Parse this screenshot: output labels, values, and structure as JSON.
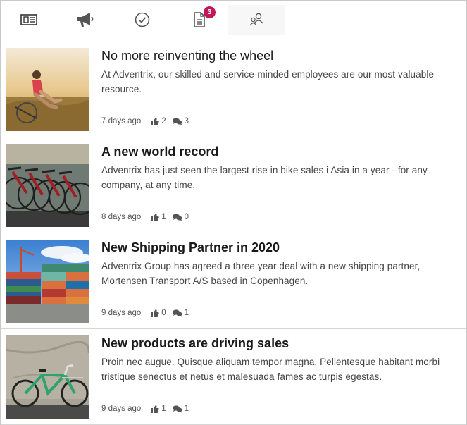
{
  "tabs": [
    {
      "icon": "newspaper-icon",
      "label": ""
    },
    {
      "icon": "megaphone-icon",
      "label": ""
    },
    {
      "icon": "check-circle-icon",
      "label": ""
    },
    {
      "icon": "document-icon",
      "badge": "3"
    },
    {
      "icon": "people-icon",
      "active": true
    }
  ],
  "colors": {
    "badge": "#c0185a",
    "icon": "#555555",
    "divider": "#d6d6d6"
  },
  "news": [
    {
      "title": "No more reinventing the wheel",
      "body": "At Adventrix, our skilled and service-minded employees are our most valuable resource.",
      "age": "7 days ago",
      "likes": "2",
      "comments": "3",
      "image": "woman-sitting-in-field-photo"
    },
    {
      "title": "A new world record",
      "body": "Adventrix has just seen the largest rise in bike sales i Asia in a year - for any company, at any time.",
      "age": "8 days ago",
      "likes": "1",
      "comments": "0",
      "image": "rows-of-bicycles-photo"
    },
    {
      "title": "New Shipping Partner in 2020",
      "body": "Adventrix Group has agreed a three year deal with a new shipping partner, Mortensen Transport A/S based in Copenhagen.",
      "age": "9 days ago",
      "likes": "0",
      "comments": "1",
      "image": "shipping-containers-photo"
    },
    {
      "title": "New products are driving sales",
      "body": "Proin nec augue. Quisque aliquam tempor magna. Pellentesque habitant morbi tristique senectus et netus et malesuada fames ac turpis egestas.",
      "age": "9 days ago",
      "likes": "1",
      "comments": "1",
      "image": "green-bicycle-photo"
    }
  ]
}
